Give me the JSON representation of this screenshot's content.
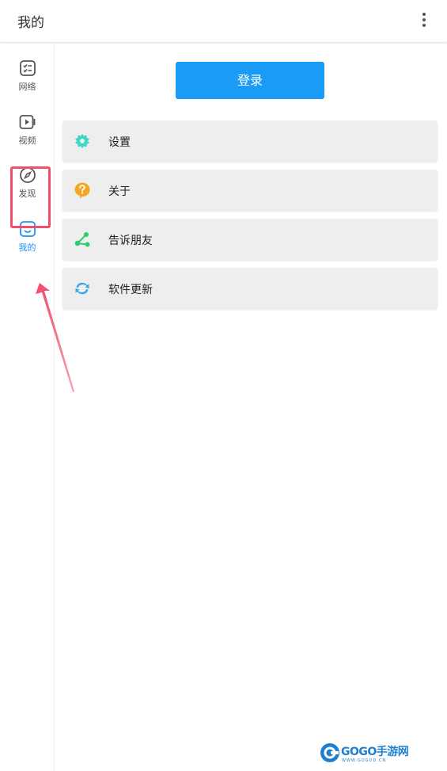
{
  "header": {
    "title": "我的",
    "menu_icon": "more-vertical-icon"
  },
  "sidebar": {
    "items": [
      {
        "label": "网络",
        "icon": "checklist-icon"
      },
      {
        "label": "视频",
        "icon": "video-icon"
      },
      {
        "label": "发现",
        "icon": "compass-icon"
      },
      {
        "label": "我的",
        "icon": "smiley-face-icon",
        "active": true
      }
    ]
  },
  "main": {
    "login_label": "登录",
    "menu": [
      {
        "label": "设置",
        "icon": "gear-icon",
        "color": "#3dd9c6"
      },
      {
        "label": "关于",
        "icon": "question-icon",
        "color": "#f5a623"
      },
      {
        "label": "告诉朋友",
        "icon": "share-icon",
        "color": "#2ecc71"
      },
      {
        "label": "软件更新",
        "icon": "refresh-icon",
        "color": "#2aa7f0"
      }
    ]
  },
  "watermark": {
    "text": "GOGO手游网",
    "sub": "WWW.GOGOD.CN"
  },
  "colors": {
    "accent": "#1a9cf6",
    "highlight": "#f0506e"
  }
}
